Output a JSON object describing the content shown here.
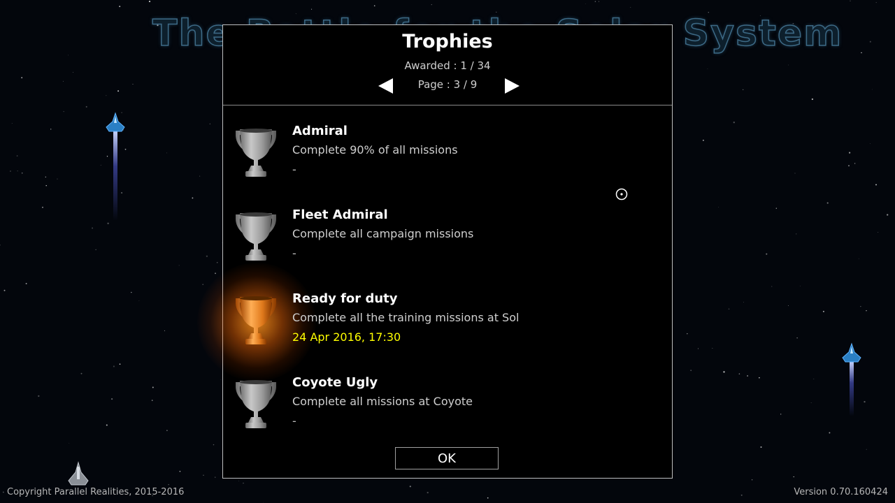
{
  "background": {
    "title_text": "The Battle for the Solar System"
  },
  "dialog": {
    "title": "Trophies",
    "awarded": "Awarded : 1 / 34",
    "page": "Page : 3 / 9",
    "prev_icon": "left-arrow-icon",
    "next_icon": "right-arrow-icon",
    "ok_label": "OK",
    "trophies": [
      {
        "name": "Admiral",
        "description": "Complete 90% of all missions",
        "date": "-",
        "awarded": false,
        "icon": "trophy-silver-icon"
      },
      {
        "name": "Fleet Admiral",
        "description": "Complete all campaign missions",
        "date": "-",
        "awarded": false,
        "icon": "trophy-silver-icon"
      },
      {
        "name": "Ready for duty",
        "description": "Complete all the training missions at Sol",
        "date": "24 Apr 2016, 17:30",
        "awarded": true,
        "icon": "trophy-bronze-icon"
      },
      {
        "name": "Coyote Ugly",
        "description": "Complete all missions at Coyote",
        "date": "-",
        "awarded": false,
        "icon": "trophy-silver-icon"
      }
    ]
  },
  "footer": {
    "copyright": "Copyright Parallel Realities, 2015-2016",
    "version": "Version 0.70.160424"
  },
  "colors": {
    "awarded_date": "#ffff00",
    "dialog_border": "#bfbfbf",
    "bronze": "#e07a1c",
    "silver": "#9a9a9a"
  }
}
